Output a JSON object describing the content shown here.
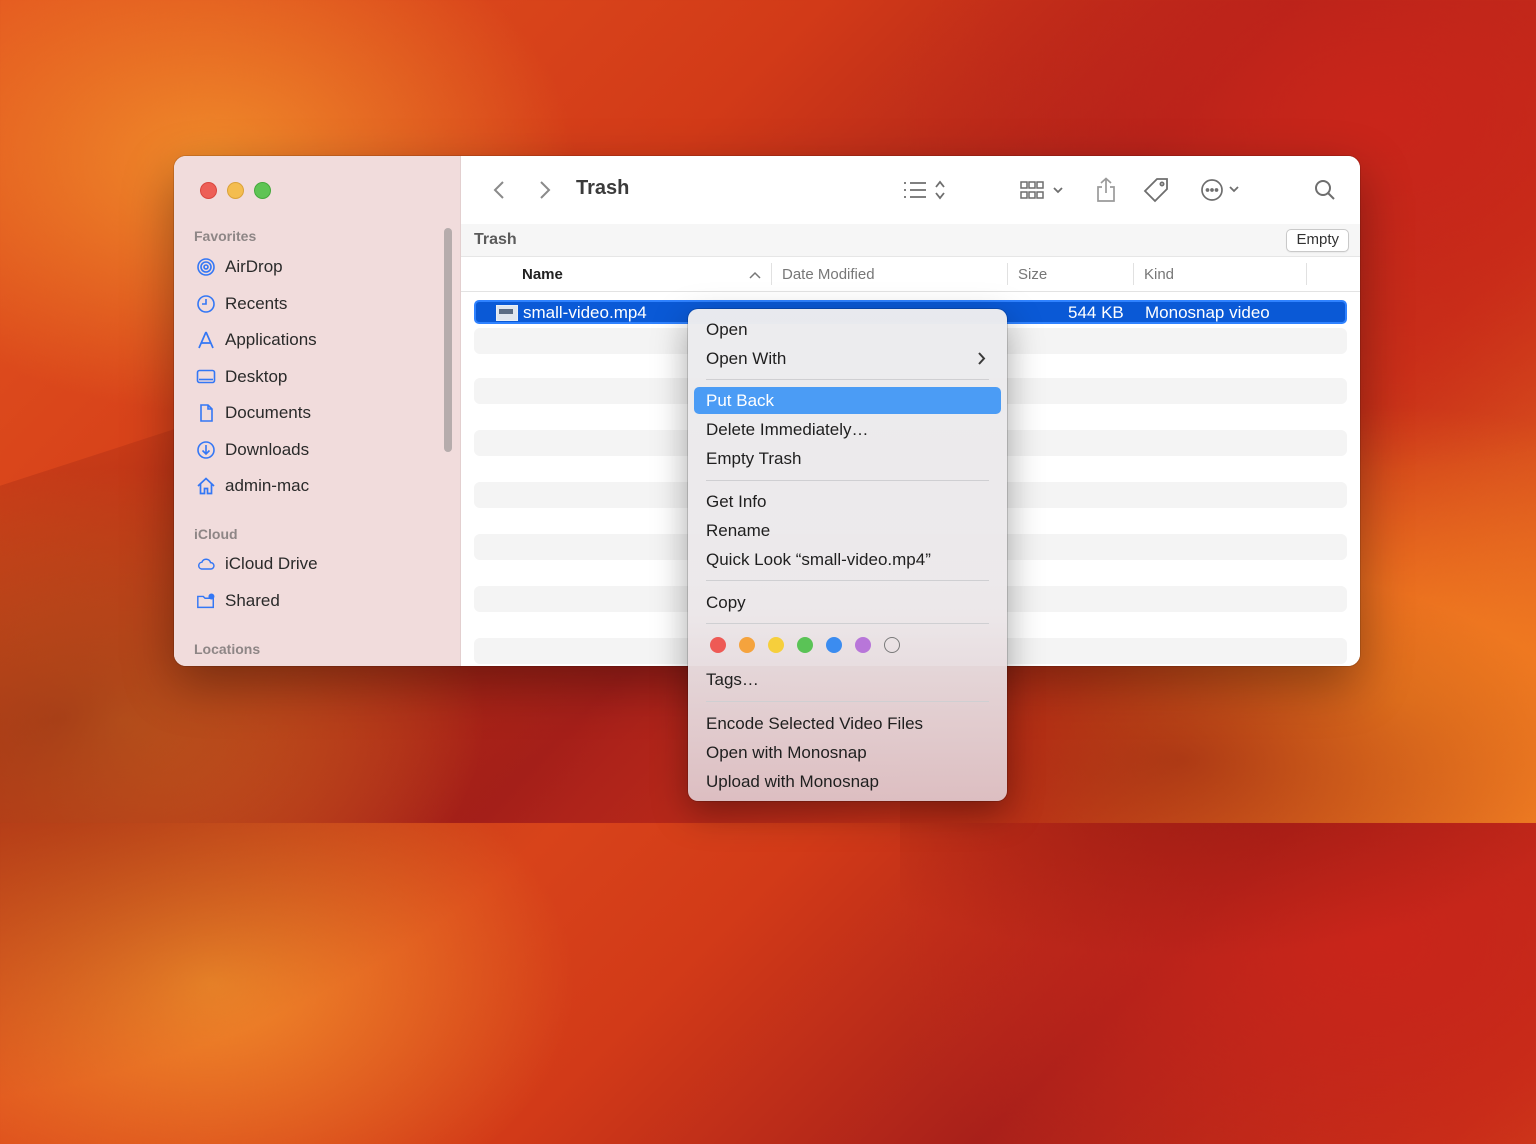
{
  "window": {
    "title": "Trash",
    "path_label": "Trash",
    "empty_button": "Empty"
  },
  "sidebar": {
    "favorites_label": "Favorites",
    "favorites": [
      {
        "label": "AirDrop",
        "icon": "airdrop-icon"
      },
      {
        "label": "Recents",
        "icon": "clock-icon"
      },
      {
        "label": "Applications",
        "icon": "applications-icon"
      },
      {
        "label": "Desktop",
        "icon": "desktop-icon"
      },
      {
        "label": "Documents",
        "icon": "document-icon"
      },
      {
        "label": "Downloads",
        "icon": "download-icon"
      },
      {
        "label": "admin-mac",
        "icon": "home-icon"
      }
    ],
    "icloud_label": "iCloud",
    "icloud": [
      {
        "label": "iCloud Drive",
        "icon": "cloud-icon"
      },
      {
        "label": "Shared",
        "icon": "shared-folder-icon"
      }
    ],
    "locations_label": "Locations"
  },
  "columns": {
    "name": "Name",
    "date_modified": "Date Modified",
    "size": "Size",
    "kind": "Kind"
  },
  "files": [
    {
      "name": "small-video.mp4",
      "size": "544 KB",
      "kind": "Monosnap video"
    }
  ],
  "context_menu": {
    "items": [
      "Open",
      "Open With",
      "Put Back",
      "Delete Immediately…",
      "Empty Trash",
      "Get Info",
      "Rename",
      "Quick Look “small-video.mp4”",
      "Copy",
      "Tags…",
      "Encode Selected Video Files",
      "Open with Monosnap",
      "Upload with Monosnap"
    ],
    "highlighted": "Put Back",
    "tag_colors": [
      "#ee5a55",
      "#f5a33d",
      "#f6cf3c",
      "#5ac356",
      "#3b8cf0",
      "#b876d9",
      "#ffffff"
    ]
  },
  "colors": {
    "selection": "#0a59d6",
    "menu_highlight": "#4b9cf5",
    "sidebar_icon": "#3477f5"
  }
}
